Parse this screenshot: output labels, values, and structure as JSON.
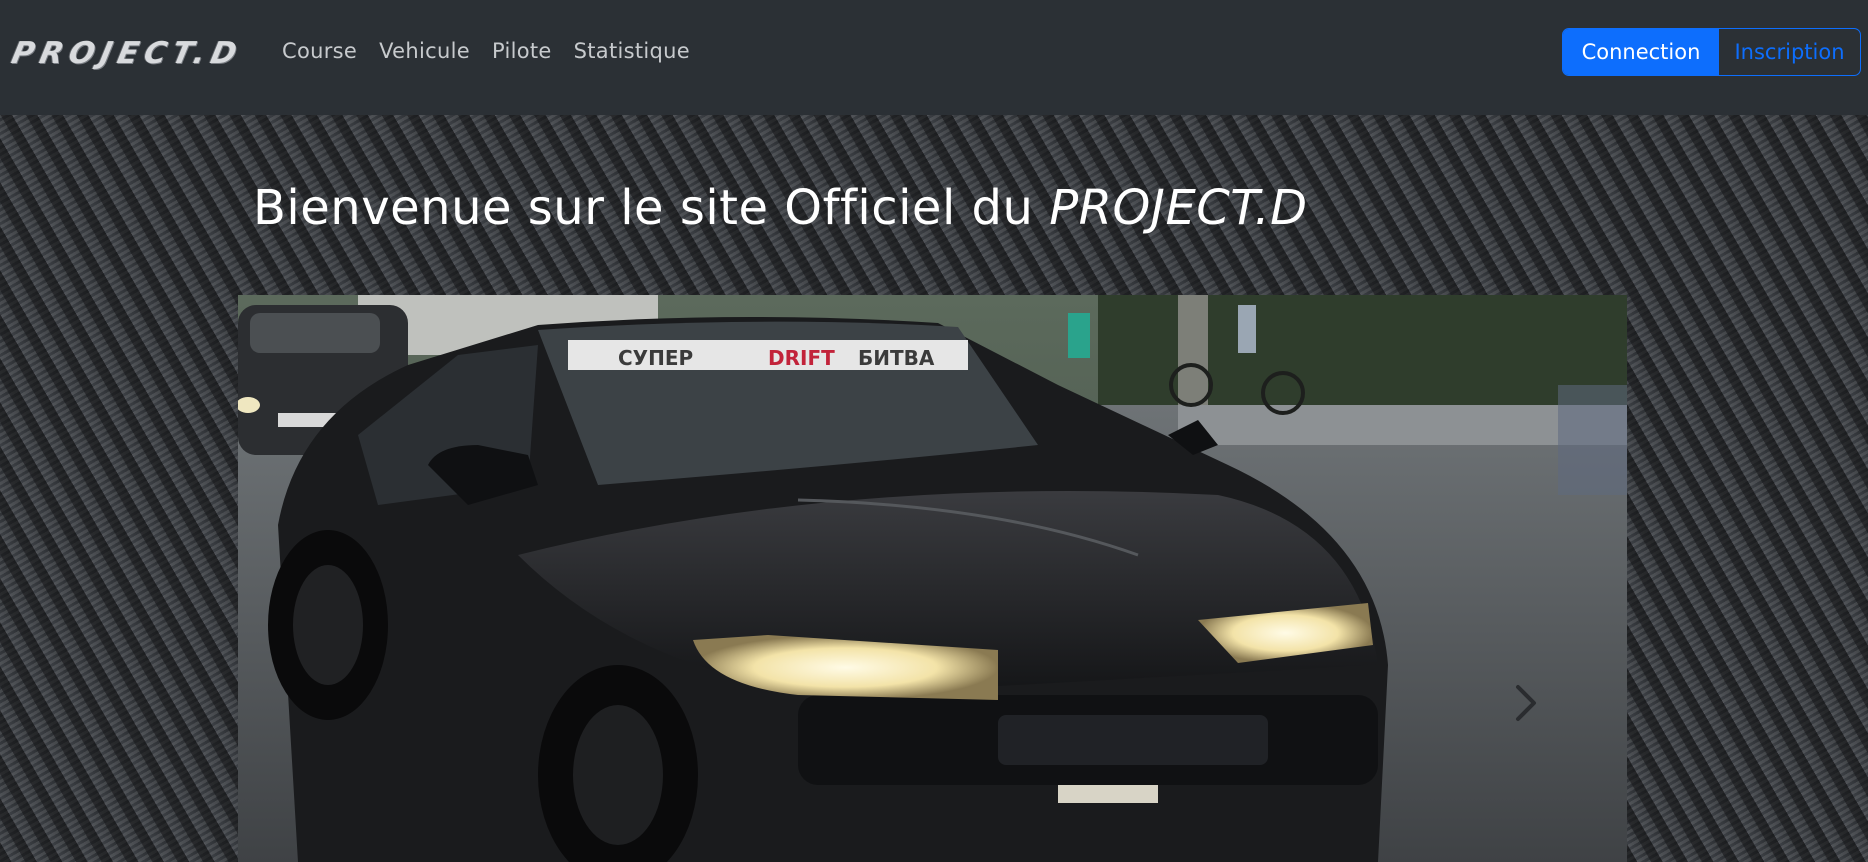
{
  "navbar": {
    "brand": "PROJECT.D",
    "links": [
      "Course",
      "Vehicule",
      "Pilote",
      "Statistique"
    ],
    "login_label": "Connection",
    "signup_label": "Inscription"
  },
  "hero": {
    "title_prefix": "Bienvenue sur le site Officiel du",
    "title_brand": "PROJECT.D"
  },
  "carousel": {
    "slide_icon": "drift-car-photo",
    "next_icon": "chevron-right-icon",
    "windshield_banner": [
      "СУПЕР",
      "DRIFT",
      "БИТВА"
    ]
  },
  "colors": {
    "navbar_bg": "#2b3035",
    "primary": "#0d6efd",
    "text_light": "#ffffff",
    "nav_text": "#c7cacd"
  }
}
